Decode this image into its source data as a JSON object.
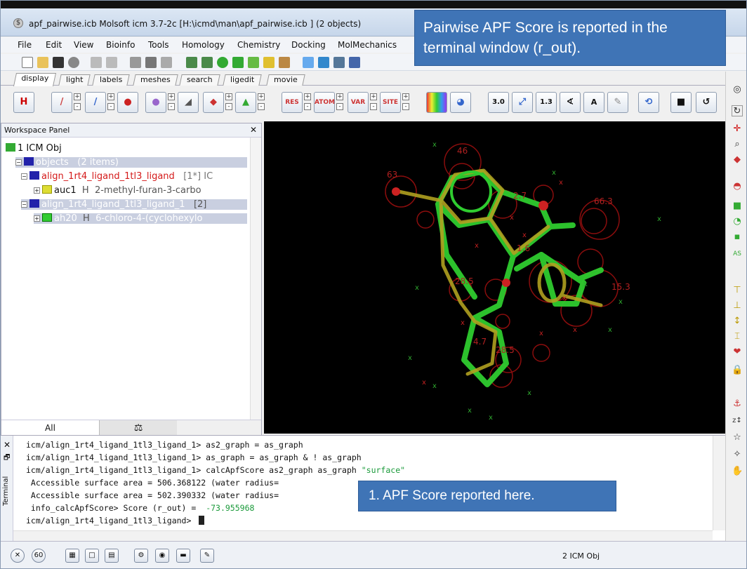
{
  "window": {
    "title": "apf_pairwise.icb Molsoft icm 3.7-2c  [H:\\icmd\\man\\apf_pairwise.icb ] (2 objects)"
  },
  "menu": [
    "File",
    "Edit",
    "View",
    "Bioinfo",
    "Tools",
    "Homology",
    "Chemistry",
    "Docking",
    "MolMechanics"
  ],
  "tabs": [
    "display",
    "light",
    "labels",
    "meshes",
    "search",
    "ligedit",
    "movie"
  ],
  "workspace": {
    "title": "Workspace Panel",
    "root": "1 ICM Obj",
    "objects_label": "objects",
    "objects_count": "(2 items)",
    "obj1_name": "align_1rt4_ligand_1tl3_ligand",
    "obj1_tag": "[1*] IC",
    "obj1_child_name": "auc1",
    "obj1_child_h": "H",
    "obj1_child_desc": "2-methyl-furan-3-carbo",
    "obj2_name": "align_1rt4_ligand_1tl3_ligand_1",
    "obj2_tag": "[2]",
    "obj2_child_name": "ah20",
    "obj2_child_h": "H",
    "obj2_child_desc": "6-chloro-4-(cyclohexylo",
    "tab_all": "All",
    "tab_other": "⚖"
  },
  "terminal": {
    "side_label": "Terminal",
    "lines": [
      "icm/align_1rt4_ligand_1tl3_ligand_1> as2_graph = as_graph",
      "icm/align_1rt4_ligand_1tl3_ligand_1> as_graph = as_graph & ! as_graph",
      "icm/align_1rt4_ligand_1tl3_ligand_1> calcApfScore as2_graph as_graph ",
      " Accessible surface area = 506.368122 (water radius=",
      " Accessible surface area = 502.390332 (water radius=",
      " info_calcApfScore> Score (r_out) =  ",
      "icm/align_1rt4_ligand_1tl3_ligand> "
    ],
    "surface_arg": "\"surface\"",
    "score_value": "-73.955968"
  },
  "status": {
    "text": "2 ICM Obj"
  },
  "callouts": {
    "top": "Pairwise APF Score is reported in the terminal window (r_out).",
    "bottom": "1. APF Score reported here."
  },
  "colors": {
    "callout": "#3f74b6",
    "obj_red": "#d41a1a",
    "term_green": "#1a9a3a"
  }
}
